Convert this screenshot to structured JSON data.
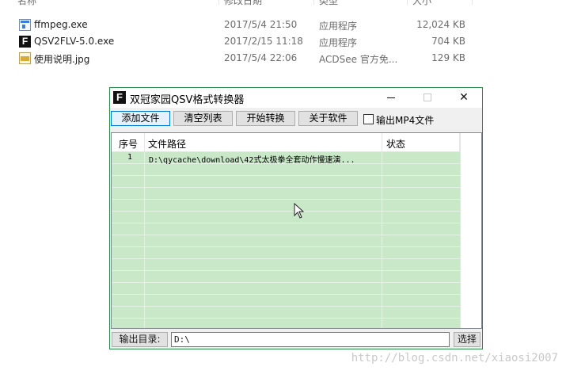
{
  "explorer": {
    "columns": {
      "name": "名称",
      "date": "修改日期",
      "type": "类型",
      "size": "大小"
    },
    "files": [
      {
        "icon": "exe-icon",
        "name": "ffmpeg.exe",
        "date": "2017/5/4 21:50",
        "type": "应用程序",
        "size": "12,024 KB"
      },
      {
        "icon": "app-f-icon",
        "name": "QSV2FLV-5.0.exe",
        "date": "2017/2/15 11:18",
        "type": "应用程序",
        "size": "704 KB"
      },
      {
        "icon": "jpg-icon",
        "name": "使用说明.jpg",
        "date": "2017/5/4 22:06",
        "type": "ACDSee 官方免...",
        "size": "129 KB"
      }
    ]
  },
  "window": {
    "icon_letter": "F",
    "title": "双冠家园QSV格式转换器",
    "accent_color": "#2a8a4a",
    "controls": {
      "minimize": "minimize-icon",
      "maximize": "maximize-icon",
      "close": "✕"
    }
  },
  "toolbar": {
    "add_file": "添加文件",
    "clear_list": "清空列表",
    "start_convert": "开始转换",
    "about": "关于软件",
    "output_mp4_label": "输出MP4文件",
    "output_mp4_checked": false
  },
  "list": {
    "headers": {
      "index": "序号",
      "path": "文件路径",
      "status": "状态"
    },
    "row_color": "#c8e8c8",
    "rows": [
      {
        "index": "1",
        "path": "D:\\qycache\\download\\42式太极拳全套动作慢速演...",
        "status": ""
      }
    ]
  },
  "output": {
    "label": "输出目录:",
    "value": "D:\\",
    "choose_button": "选择"
  },
  "watermark": "http://blog.csdn.net/xiaosi2007"
}
